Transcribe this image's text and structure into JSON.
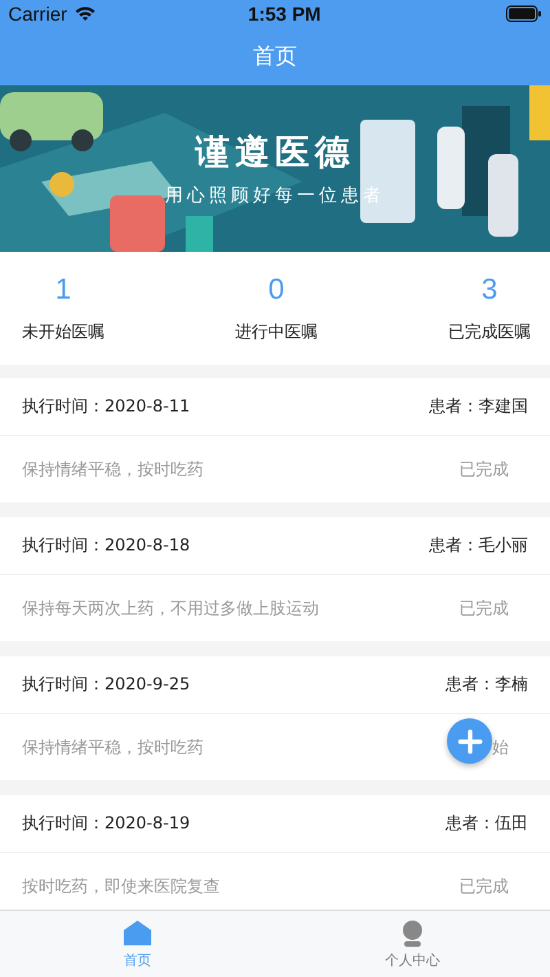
{
  "status_bar": {
    "carrier": "Carrier",
    "time": "1:53 PM"
  },
  "nav": {
    "title": "首页"
  },
  "banner": {
    "kind": "picture",
    "title": "谨遵医德",
    "subtitle": "用心照顾好每一位患者"
  },
  "stats": [
    {
      "count": "1",
      "label": "未开始医嘱"
    },
    {
      "count": "0",
      "label": "进行中医嘱"
    },
    {
      "count": "3",
      "label": "已完成医嘱"
    }
  ],
  "orders": [
    {
      "time": "执行时间：2020-8-11",
      "patient": "患者：李建国",
      "note": "保持情绪平稳，按时吃药",
      "status": "已完成"
    },
    {
      "time": "执行时间：2020-8-18",
      "patient": "患者：毛小丽",
      "note": "保持每天两次上药，不用过多做上肢运动",
      "status": "已完成"
    },
    {
      "time": "执行时间：2020-9-25",
      "patient": "患者：李楠",
      "note": "保持情绪平稳，按时吃药",
      "status": "始"
    },
    {
      "time": "执行时间：2020-8-19",
      "patient": "患者：伍田",
      "note": "按时吃药，即使来医院复查",
      "status": "已完成"
    }
  ],
  "tabs": [
    {
      "label": "首页",
      "kind": "home",
      "selected": true
    },
    {
      "label": "个人中心",
      "kind": "person",
      "selected": false
    }
  ]
}
